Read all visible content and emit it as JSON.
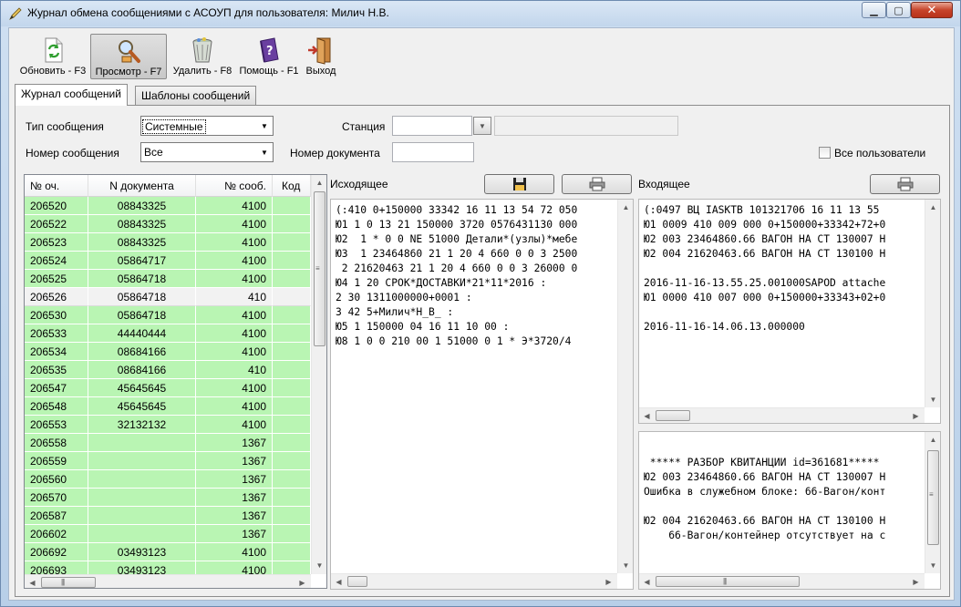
{
  "window": {
    "title": "Журнал обмена сообщениями с АСОУП для пользователя: Милич Н.В.",
    "controls": {
      "minimize": "▁",
      "maximize": "▢",
      "close": "✕"
    }
  },
  "toolbar": {
    "buttons": [
      {
        "label": "Обновить - F3",
        "icon": "refresh-icon"
      },
      {
        "label": "Просмотр - F7",
        "icon": "search-icon",
        "active": true
      },
      {
        "label": "Удалить - F8",
        "icon": "trash-icon"
      },
      {
        "label": "Помощь - F1",
        "icon": "help-book-icon"
      },
      {
        "label": "Выход",
        "icon": "exit-door-icon"
      }
    ]
  },
  "tabs": [
    {
      "label": "Журнал сообщений",
      "active": true
    },
    {
      "label": "Шаблоны сообщений",
      "active": false
    }
  ],
  "filters": {
    "message_type_label": "Тип сообщения",
    "message_type_value": "Системные",
    "message_number_label": "Номер сообщения",
    "message_number_value": "Все",
    "station_label": "Станция",
    "station_value": "",
    "document_number_label": "Номер документа",
    "document_number_value": "",
    "all_users_label": "Все пользователи",
    "all_users_checked": false
  },
  "grid": {
    "columns": [
      "№ оч.",
      "N документа",
      "№ сооб.",
      "Код"
    ],
    "rows": [
      {
        "queue": "206520",
        "doc": "08843325",
        "msg": "4100",
        "code": "",
        "color": "green"
      },
      {
        "queue": "206522",
        "doc": "08843325",
        "msg": "4100",
        "code": "",
        "color": "green"
      },
      {
        "queue": "206523",
        "doc": "08843325",
        "msg": "4100",
        "code": "",
        "color": "green"
      },
      {
        "queue": "206524",
        "doc": "05864717",
        "msg": "4100",
        "code": "",
        "color": "green"
      },
      {
        "queue": "206525",
        "doc": "05864718",
        "msg": "4100",
        "code": "",
        "color": "green"
      },
      {
        "queue": "206526",
        "doc": "05864718",
        "msg": "410",
        "code": "",
        "color": "selected"
      },
      {
        "queue": "206530",
        "doc": "05864718",
        "msg": "4100",
        "code": "",
        "color": "green"
      },
      {
        "queue": "206533",
        "doc": "44440444",
        "msg": "4100",
        "code": "",
        "color": "green"
      },
      {
        "queue": "206534",
        "doc": "08684166",
        "msg": "4100",
        "code": "",
        "color": "green"
      },
      {
        "queue": "206535",
        "doc": "08684166",
        "msg": "410",
        "code": "",
        "color": "green"
      },
      {
        "queue": "206547",
        "doc": "45645645",
        "msg": "4100",
        "code": "",
        "color": "green"
      },
      {
        "queue": "206548",
        "doc": "45645645",
        "msg": "4100",
        "code": "",
        "color": "green"
      },
      {
        "queue": "206553",
        "doc": "32132132",
        "msg": "4100",
        "code": "",
        "color": "green"
      },
      {
        "queue": "206558",
        "doc": "",
        "msg": "1367",
        "code": "",
        "color": "green"
      },
      {
        "queue": "206559",
        "doc": "",
        "msg": "1367",
        "code": "",
        "color": "green"
      },
      {
        "queue": "206560",
        "doc": "",
        "msg": "1367",
        "code": "",
        "color": "green"
      },
      {
        "queue": "206570",
        "doc": "",
        "msg": "1367",
        "code": "",
        "color": "green"
      },
      {
        "queue": "206587",
        "doc": "",
        "msg": "1367",
        "code": "",
        "color": "green"
      },
      {
        "queue": "206602",
        "doc": "",
        "msg": "1367",
        "code": "",
        "color": "green"
      },
      {
        "queue": "206692",
        "doc": "03493123",
        "msg": "4100",
        "code": "",
        "color": "green"
      },
      {
        "queue": "206693",
        "doc": "03493123",
        "msg": "4100",
        "code": "",
        "color": "green"
      }
    ]
  },
  "outgoing": {
    "title": "Исходящее",
    "text": "(:410 0+150000 33342 16 11 13 54 72 050\nЮ1 1 0 13 21 150000 3720 0576431130 000\nЮ2  1 * 0 0 NE 51000 Детали*(узлы)*мебе\nЮ3  1 23464860 21 1 20 4 660 0 0 3 2500\n 2 21620463 21 1 20 4 660 0 0 3 26000 0\nЮ4 1 20 СРОК*ДОСТАВКИ*21*11*2016 :\n2 30 1311000000+0001 :\n3 42 5+Милич*Н_В_ :\nЮ5 1 150000 04 16 11 10 00 :\nЮ8 1 0 0 210 00 1 51000 0 1 * Э*3720/4"
  },
  "incoming": {
    "title": "Входящее",
    "text": "(:0497 ВЦ IASKTB 101321706 16 11 13 55\nЮ1 0009 410 009 000 0+150000+33342+72+0\nЮ2 003 23464860.66 ВАГОН НА СТ 130007 Н\nЮ2 004 21620463.66 ВАГОН НА СТ 130100 Н\n\n2016-11-16-13.55.25.001000SAPOD attache\nЮ1 0000 410 007 000 0+150000+33343+02+0\n\n2016-11-16-14.06.13.000000"
  },
  "receipt": {
    "text": "\n ***** РАЗБОР КВИТАНЦИИ id=361681*****\nЮ2 003 23464860.66 ВАГОН НА СТ 130007 Н\nОшибка в служебном блоке: 66-Вагон/конт\n\nЮ2 004 21620463.66 ВАГОН НА СТ 130100 Н\n    66-Вагон/контейнер отсутствует на с"
  },
  "colors": {
    "row_green": "#b9f5b3",
    "row_selected": "#f2f2f2",
    "close_button": "#c7442b",
    "window_frame": "#c2d6ec"
  }
}
